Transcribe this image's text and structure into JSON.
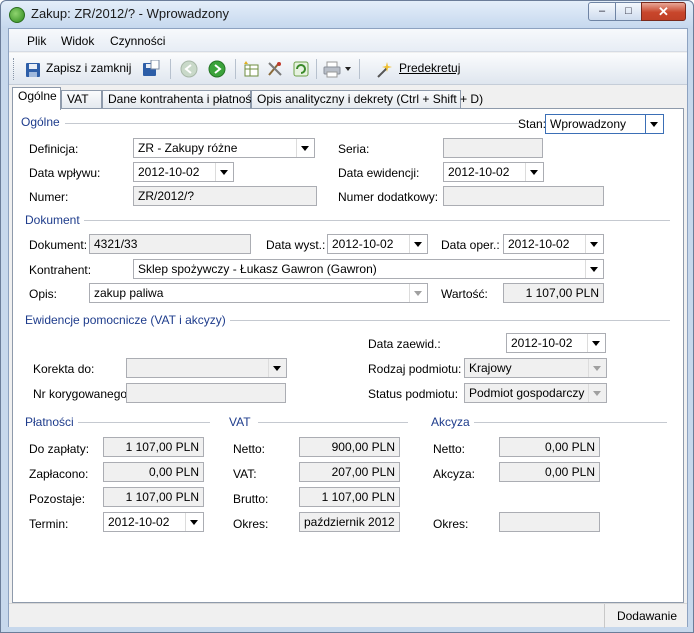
{
  "window": {
    "title": "Zakup: ZR/2012/? - Wprowadzony"
  },
  "menu": {
    "file": "Plik",
    "view": "Widok",
    "actions": "Czynności"
  },
  "toolbar": {
    "save_close": "Zapisz i zamknij",
    "predecree": "Predekretuj"
  },
  "tabs": [
    "Ogólne",
    "VAT",
    "Dane kontrahenta i płatności",
    "Opis analityczny i dekrety (Ctrl + Shift + D)"
  ],
  "general": {
    "section": "Ogólne",
    "stan_label": "Stan:",
    "stan_value": "Wprowadzony",
    "definicja_label": "Definicja:",
    "definicja_value": "ZR - Zakupy różne",
    "seria_label": "Seria:",
    "seria_value": "",
    "data_wplywu_label": "Data wpływu:",
    "data_wplywu_value": "2012-10-02",
    "data_ewidencji_label": "Data ewidencji:",
    "data_ewidencji_value": "2012-10-02",
    "numer_label": "Numer:",
    "numer_value": "ZR/2012/?",
    "numer_dod_label": "Numer dodatkowy:",
    "numer_dod_value": ""
  },
  "document": {
    "section": "Dokument",
    "dokument_label": "Dokument:",
    "dokument_value": "4321/33",
    "data_wyst_label": "Data wyst.:",
    "data_wyst_value": "2012-10-02",
    "data_oper_label": "Data oper.:",
    "data_oper_value": "2012-10-02",
    "kontrahent_label": "Kontrahent:",
    "kontrahent_value": "Sklep spożywczy - Łukasz Gawron (Gawron)",
    "opis_label": "Opis:",
    "opis_value": "zakup paliwa",
    "wartosc_label": "Wartość:",
    "wartosc_value": "1 107,00 PLN"
  },
  "aux": {
    "section": "Ewidencje pomocnicze (VAT i akcyzy)",
    "data_zaewid_label": "Data zaewid.:",
    "data_zaewid_value": "2012-10-02",
    "korekta_label": "Korekta do:",
    "korekta_value": "",
    "rodzaj_label": "Rodzaj podmiotu:",
    "rodzaj_value": "Krajowy",
    "nr_kor_label": "Nr korygowanego:",
    "nr_kor_value": "",
    "status_label": "Status podmiotu:",
    "status_value": "Podmiot gospodarczy"
  },
  "payments": {
    "section": "Płatności",
    "do_zaplaty_label": "Do zapłaty:",
    "do_zaplaty_value": "1 107,00 PLN",
    "zaplacono_label": "Zapłacono:",
    "zaplacono_value": "0,00 PLN",
    "pozostaje_label": "Pozostaje:",
    "pozostaje_value": "1 107,00 PLN",
    "termin_label": "Termin:",
    "termin_value": "2012-10-02"
  },
  "vat": {
    "section": "VAT",
    "netto_label": "Netto:",
    "netto_value": "900,00 PLN",
    "vat_label": "VAT:",
    "vat_value": "207,00 PLN",
    "brutto_label": "Brutto:",
    "brutto_value": "1 107,00 PLN",
    "okres_label": "Okres:",
    "okres_value": "październik 2012"
  },
  "excise": {
    "section": "Akcyza",
    "netto_label": "Netto:",
    "netto_value": "0,00 PLN",
    "akcyza_label": "Akcyza:",
    "akcyza_value": "0,00 PLN",
    "okres_label": "Okres:",
    "okres_value": ""
  },
  "status": {
    "mode": "Dodawanie"
  }
}
